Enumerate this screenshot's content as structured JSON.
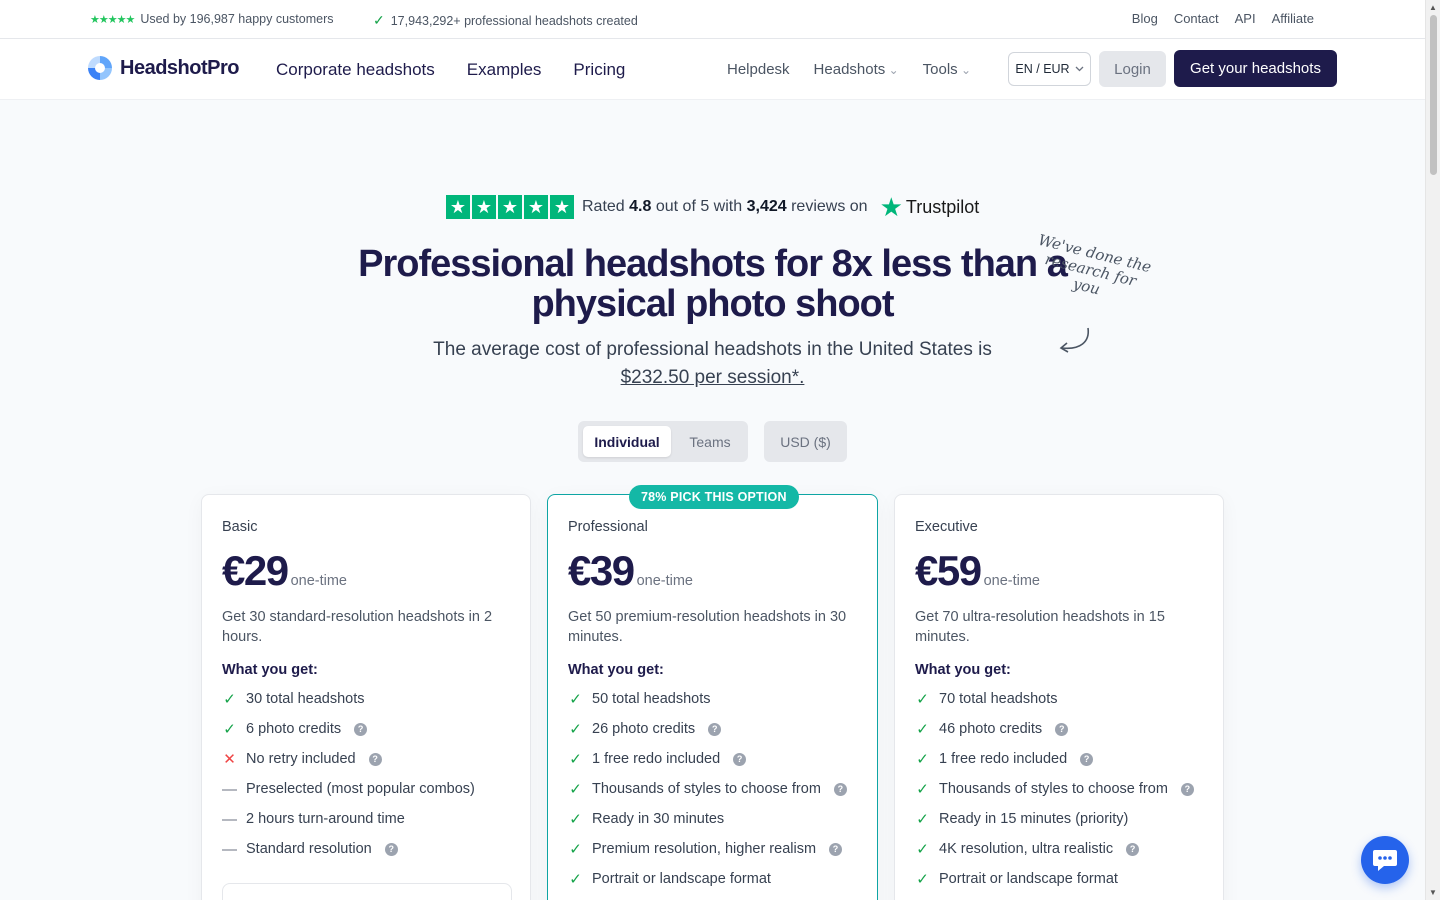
{
  "topbar": {
    "customers": "Used by 196,987 happy customers",
    "headshots": "17,943,292+ professional headshots created",
    "links": [
      "Blog",
      "Contact",
      "API",
      "Affiliate"
    ]
  },
  "nav": {
    "brand": "HeadshotPro",
    "main": [
      "Corporate headshots",
      "Examples",
      "Pricing"
    ],
    "helpdesk": "Helpdesk",
    "headshots": "Headshots",
    "tools": "Tools",
    "language": "EN / EUR",
    "login": "Login",
    "cta": "Get your headshots"
  },
  "hero": {
    "rated_prefix": "Rated",
    "rating": "4.8",
    "rated_mid": "out of 5 with",
    "reviews": "3,424",
    "rated_suffix": "reviews on",
    "trustpilot": "Trustpilot",
    "headline": "Professional headshots for 8x less than a physical photo shoot",
    "subtitle": "The average cost of professional headshots in the United States is",
    "subtitle_link": "$232.50 per session*.",
    "handwritten": "We've done the research for you"
  },
  "toggles": {
    "individual": "Individual",
    "teams": "Teams",
    "currency": "USD ($)"
  },
  "plans": [
    {
      "name": "Basic",
      "price": "€29",
      "per": "one-time",
      "desc": "Get 30 standard-resolution headshots in 2 hours.",
      "wyg": "What you get:",
      "features": [
        {
          "text": "30 total headshots",
          "icon": "check",
          "help": false
        },
        {
          "text": "6 photo credits",
          "icon": "check",
          "help": true
        },
        {
          "text": "No retry included",
          "icon": "cross",
          "help": true
        },
        {
          "text": "Preselected (most popular combos)",
          "icon": "dash",
          "help": false
        },
        {
          "text": "2 hours turn-around time",
          "icon": "dash",
          "help": false
        },
        {
          "text": "Standard resolution",
          "icon": "dash",
          "help": true
        }
      ]
    },
    {
      "name": "Professional",
      "badge": "78% PICK THIS OPTION",
      "price": "€39",
      "per": "one-time",
      "desc": "Get 50 premium-resolution headshots in 30 minutes.",
      "wyg": "What you get:",
      "features": [
        {
          "text": "50 total headshots",
          "icon": "check",
          "help": false
        },
        {
          "text": "26 photo credits",
          "icon": "check",
          "help": true
        },
        {
          "text": "1 free redo included",
          "icon": "check",
          "help": true
        },
        {
          "text": "Thousands of styles to choose from",
          "icon": "check",
          "help": true
        },
        {
          "text": "Ready in 30 minutes",
          "icon": "check",
          "help": false
        },
        {
          "text": "Premium resolution, higher realism",
          "icon": "check",
          "help": true
        },
        {
          "text": "Portrait or landscape format",
          "icon": "check",
          "help": false
        }
      ]
    },
    {
      "name": "Executive",
      "price": "€59",
      "per": "one-time",
      "desc": "Get 70 ultra-resolution headshots in 15 minutes.",
      "wyg": "What you get:",
      "features": [
        {
          "text": "70 total headshots",
          "icon": "check",
          "help": false
        },
        {
          "text": "46 photo credits",
          "icon": "check",
          "help": true
        },
        {
          "text": "1 free redo included",
          "icon": "check",
          "help": true
        },
        {
          "text": "Thousands of styles to choose from",
          "icon": "check",
          "help": true
        },
        {
          "text": "Ready in 15 minutes (priority)",
          "icon": "check",
          "help": false
        },
        {
          "text": "4K resolution, ultra realistic",
          "icon": "check",
          "help": true
        },
        {
          "text": "Portrait or landscape format",
          "icon": "check",
          "help": false
        }
      ]
    }
  ],
  "colors": {
    "brand": "#1e1b4b",
    "accent": "#14b8a6",
    "check": "#16a34a",
    "trustpilot": "#00b67a"
  }
}
